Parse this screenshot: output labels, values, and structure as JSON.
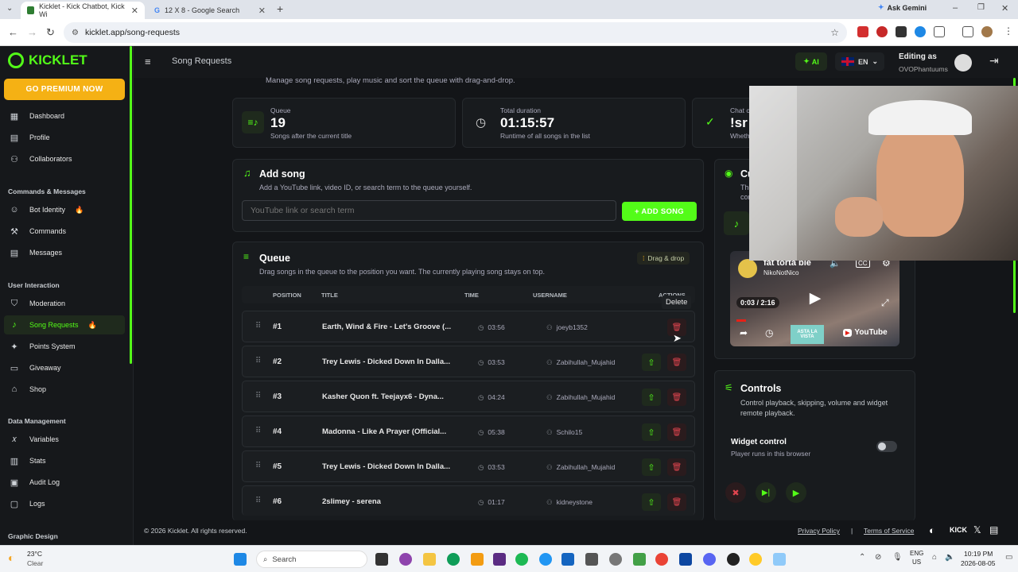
{
  "browser": {
    "tabs": [
      {
        "label": "Kicklet - Kick Chatbot, Kick Wi"
      },
      {
        "label": "12 X 8 - Google Search"
      }
    ],
    "ask_gemini": "Ask Gemini",
    "url": "kicklet.app/song-requests"
  },
  "sidebar": {
    "logo": "KICKLET",
    "premium": "GO PREMIUM NOW",
    "items_main": [
      "Dashboard",
      "Profile",
      "Collaborators"
    ],
    "sec_commands": "Commands & Messages",
    "items_commands": [
      "Bot Identity",
      "Commands",
      "Messages"
    ],
    "sec_interaction": "User Interaction",
    "items_interaction": [
      "Moderation",
      "Song Requests",
      "Points System",
      "Giveaway",
      "Shop"
    ],
    "sec_data": "Data Management",
    "items_data": [
      "Variables",
      "Stats",
      "Audit Log",
      "Logs"
    ],
    "sec_graphic": "Graphic Design"
  },
  "topbar": {
    "title": "Song Requests",
    "ai": "AI",
    "lang": "EN",
    "editing": "Editing as",
    "editing_user": "OVOPhantuums"
  },
  "page": {
    "subtitle": "Manage song requests, play music and sort the queue with drag-and-drop."
  },
  "stats": [
    {
      "label": "Queue",
      "value": "19",
      "sub": "Songs after the current title"
    },
    {
      "label": "Total duration",
      "value": "01:15:57",
      "sub": "Runtime of all songs in the list"
    },
    {
      "label": "Chat c",
      "value": "!sr",
      "sub": "Wheth"
    }
  ],
  "add_song": {
    "title": "Add song",
    "desc": "Add a YouTube link, video ID, or search term to the queue yourself.",
    "placeholder": "YouTube link or search term",
    "button": "+ ADD SONG"
  },
  "queue": {
    "title": "Queue",
    "desc": "Drag songs in the queue to the position you want. The currently playing song stays on top.",
    "badge": "Drag & drop",
    "headers": {
      "position": "POSITION",
      "title": "TITLE",
      "time": "TIME",
      "username": "USERNAME",
      "actions": "ACTIONS"
    },
    "tooltip": "Delete",
    "rows": [
      {
        "pos": "#1",
        "title": "Earth, Wind & Fire - Let's Groove (...",
        "time": "03:56",
        "user": "joeyb1352"
      },
      {
        "pos": "#2",
        "title": "Trey Lewis - Dicked Down In Dalla...",
        "time": "03:53",
        "user": "Zabihullah_Mujahid"
      },
      {
        "pos": "#3",
        "title": "Kasher Quon ft. Teejayx6 - Dyna...",
        "time": "04:24",
        "user": "Zabihullah_Mujahid"
      },
      {
        "pos": "#4",
        "title": "Madonna - Like A Prayer (Official...",
        "time": "05:38",
        "user": "Schilo15"
      },
      {
        "pos": "#5",
        "title": "Trey Lewis - Dicked Down In Dalla...",
        "time": "03:53",
        "user": "Zabihullah_Mujahid"
      },
      {
        "pos": "#6",
        "title": "2slimey - serena",
        "time": "01:17",
        "user": "kidneystone"
      }
    ]
  },
  "current": {
    "title": "Cu",
    "desc1": "The",
    "desc2": "con"
  },
  "player": {
    "video_title": "fat torta bie",
    "channel": "NikoNotNico",
    "time": "0:03 / 2:16",
    "yt": "YouTube",
    "thumb_text": "ASTA LA VISTA"
  },
  "controls": {
    "title": "Controls",
    "desc": "Control playback, skipping, volume and widget remote playback.",
    "widget_title": "Widget control",
    "widget_desc": "Player runs in this browser",
    "widget_on": false
  },
  "footer": {
    "copyright": "© 2026 Kicklet. All rights reserved.",
    "privacy": "Privacy Policy",
    "sep": "|",
    "terms": "Terms of Service",
    "kick": "KICK"
  },
  "taskbar": {
    "temp": "23°C",
    "weather": "Clear",
    "search": "Search",
    "lang1": "ENG",
    "lang2": "US",
    "time": "10:19 PM",
    "date": "2026-08-05"
  },
  "colors": {
    "accent": "#53fc18",
    "premium": "#f5b114",
    "danger": "#e0454f"
  }
}
